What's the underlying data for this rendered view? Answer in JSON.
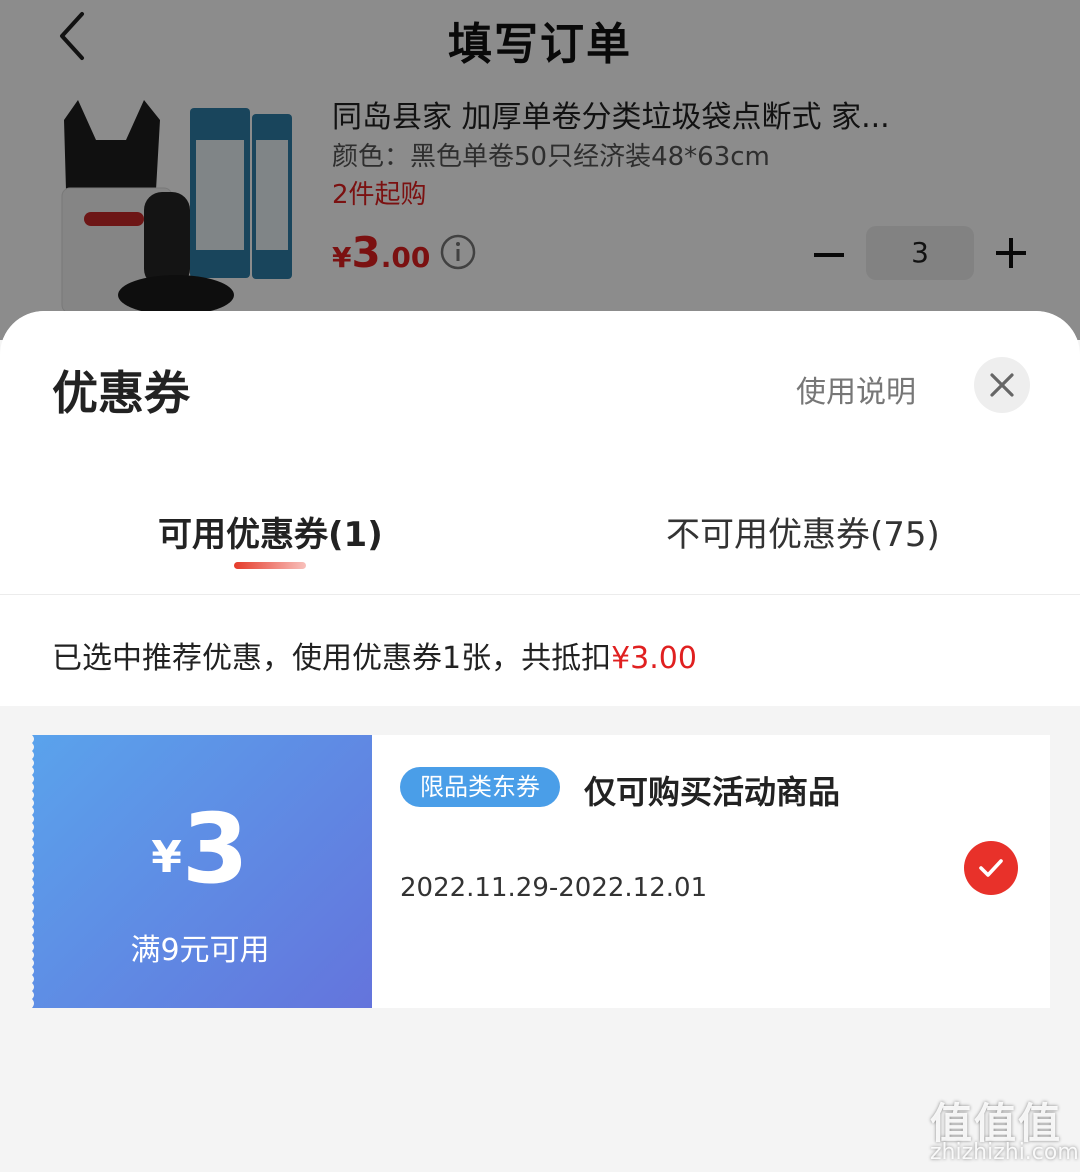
{
  "header": {
    "title": "填写订单"
  },
  "product": {
    "name": "同岛县家 加厚单卷分类垃圾袋点断式 家...",
    "spec": "颜色：黑色单卷50只经济装48*63cm",
    "min_purchase": "2件起购",
    "price_currency": "¥",
    "price_integer": "3",
    "price_decimal": ".00",
    "quantity": "3"
  },
  "sheet": {
    "title": "优惠券",
    "usage_link": "使用说明",
    "tabs": [
      {
        "label": "可用优惠券(1)",
        "active": true
      },
      {
        "label": "不可用优惠券(75)",
        "active": false
      }
    ],
    "summary_text": "已选中推荐优惠，使用优惠券1张，共抵扣",
    "summary_amount": "¥3.00"
  },
  "coupon": {
    "currency": "¥",
    "amount": "3",
    "condition": "满9元可用",
    "tag": "限品类东券",
    "description": "仅可购买活动商品",
    "date_range": "2022.11.29-2022.12.01",
    "selected": true
  },
  "watermark": {
    "logo": "值值值",
    "text": "zhizhizhi.com"
  },
  "colors": {
    "accent_red": "#e02020",
    "coupon_gradient_start": "#5aa3ec",
    "coupon_gradient_end": "#6474dc",
    "tag_blue": "#4a9ee8"
  },
  "icons": [
    "back-arrow-icon",
    "info-icon",
    "minus-icon",
    "plus-icon",
    "close-icon",
    "checkmark-icon"
  ]
}
